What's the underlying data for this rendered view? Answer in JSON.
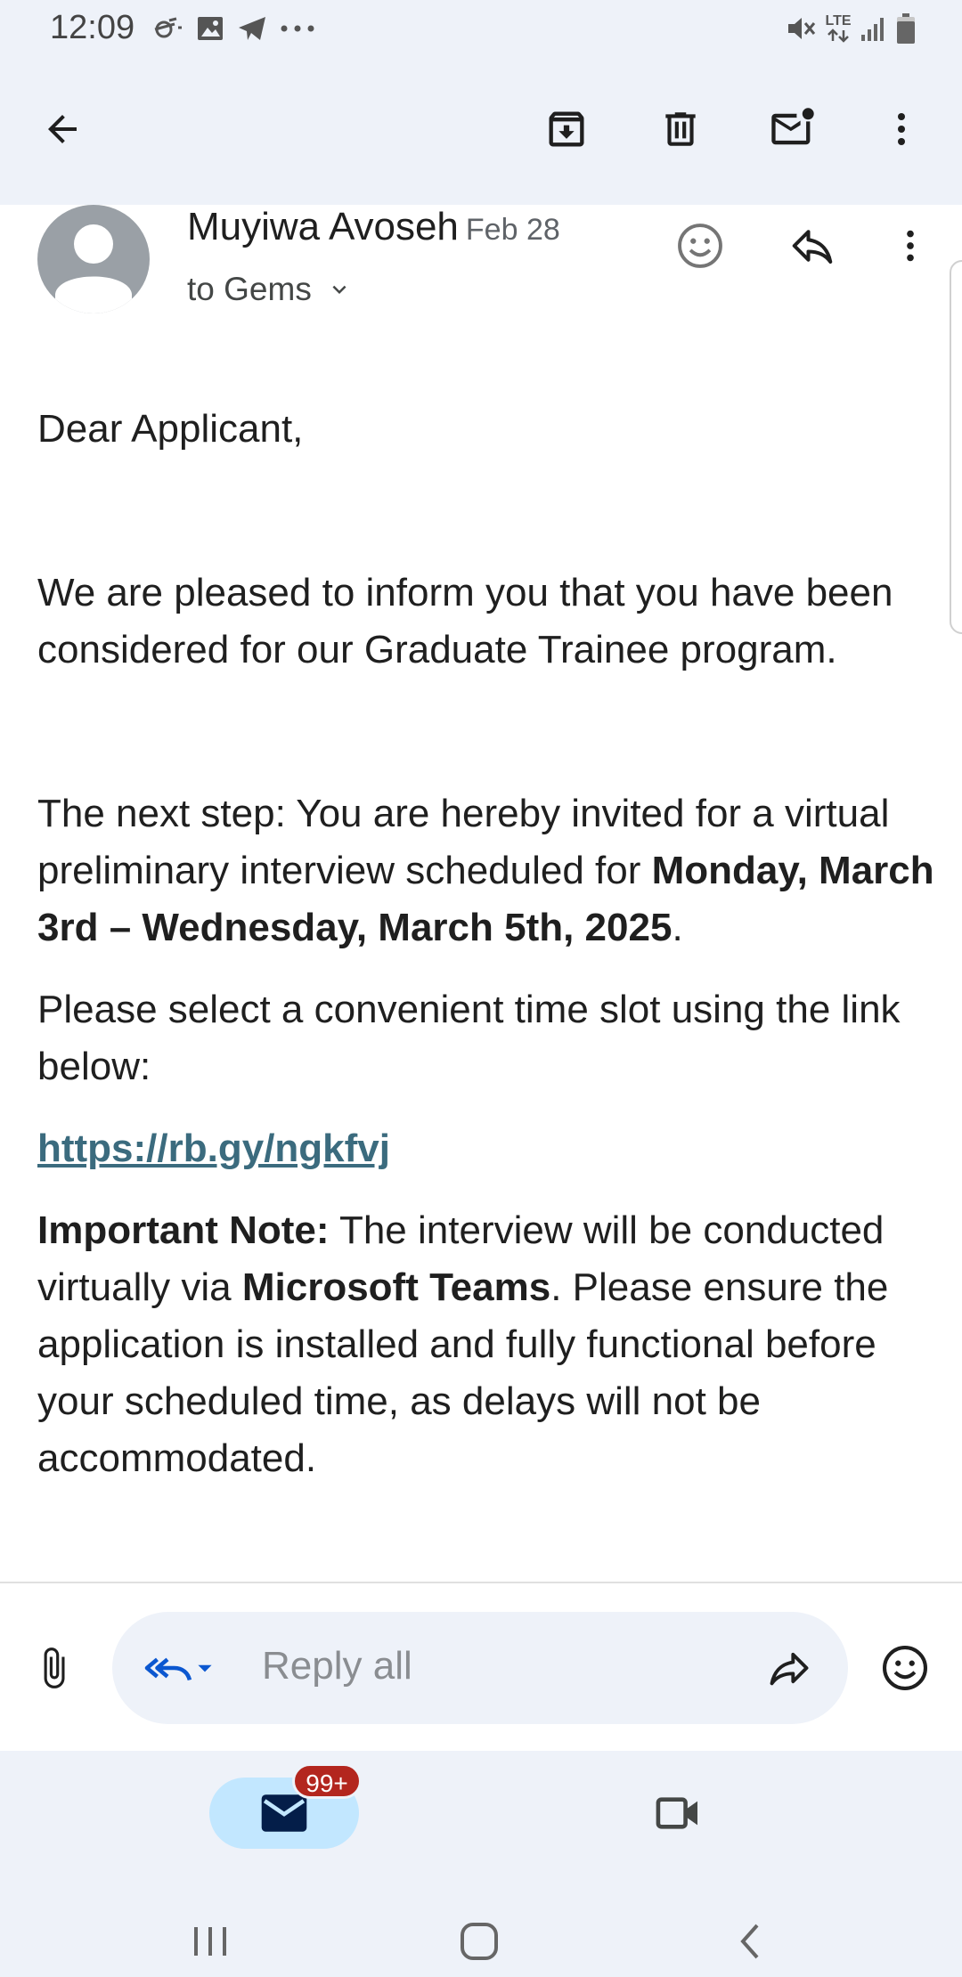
{
  "status_bar": {
    "time": "12:09",
    "left_icons": [
      "weather-icon",
      "image-icon",
      "telegram-icon",
      "more-dots-icon"
    ],
    "right_icons": [
      "mute-icon",
      "lte-icon",
      "signal-icon",
      "battery-icon"
    ],
    "network_label": "LTE"
  },
  "app_bar": {
    "actions": [
      "archive-icon",
      "delete-icon",
      "mark-unread-icon",
      "more-vert-icon"
    ]
  },
  "email": {
    "sender": "Muyiwa Avoseh",
    "date": "Feb 28",
    "recipient": "to Gems",
    "body": {
      "greeting": "Dear Applicant,",
      "p1": "We are pleased to inform you that you have been considered for our Graduate Trainee program.",
      "p2_start": "The next step: You are hereby invited for a virtual preliminary interview scheduled for ",
      "p2_bold": "Monday, March 3rd – Wednesday, March 5th, 2025",
      "p2_end": ".",
      "p3": "Please select a convenient time slot using the link below:",
      "link": "https://rb.gy/ngkfvj",
      "note_label": "Important Note:",
      "note_1": " The interview will be conducted virtually via ",
      "note_bold": "Microsoft Teams",
      "note_2": ". Please ensure the application is installed and fully functional before your scheduled time, as delays will not be accommodated."
    }
  },
  "reply_bar": {
    "placeholder": "Reply all"
  },
  "bottom_nav": {
    "mail_badge": "99+"
  },
  "colors": {
    "surface": "#eef2f9",
    "link": "#3b6b7e",
    "badge": "#b3261e",
    "active_pill": "#c2e7ff",
    "reply_accent": "#0b57d0"
  }
}
